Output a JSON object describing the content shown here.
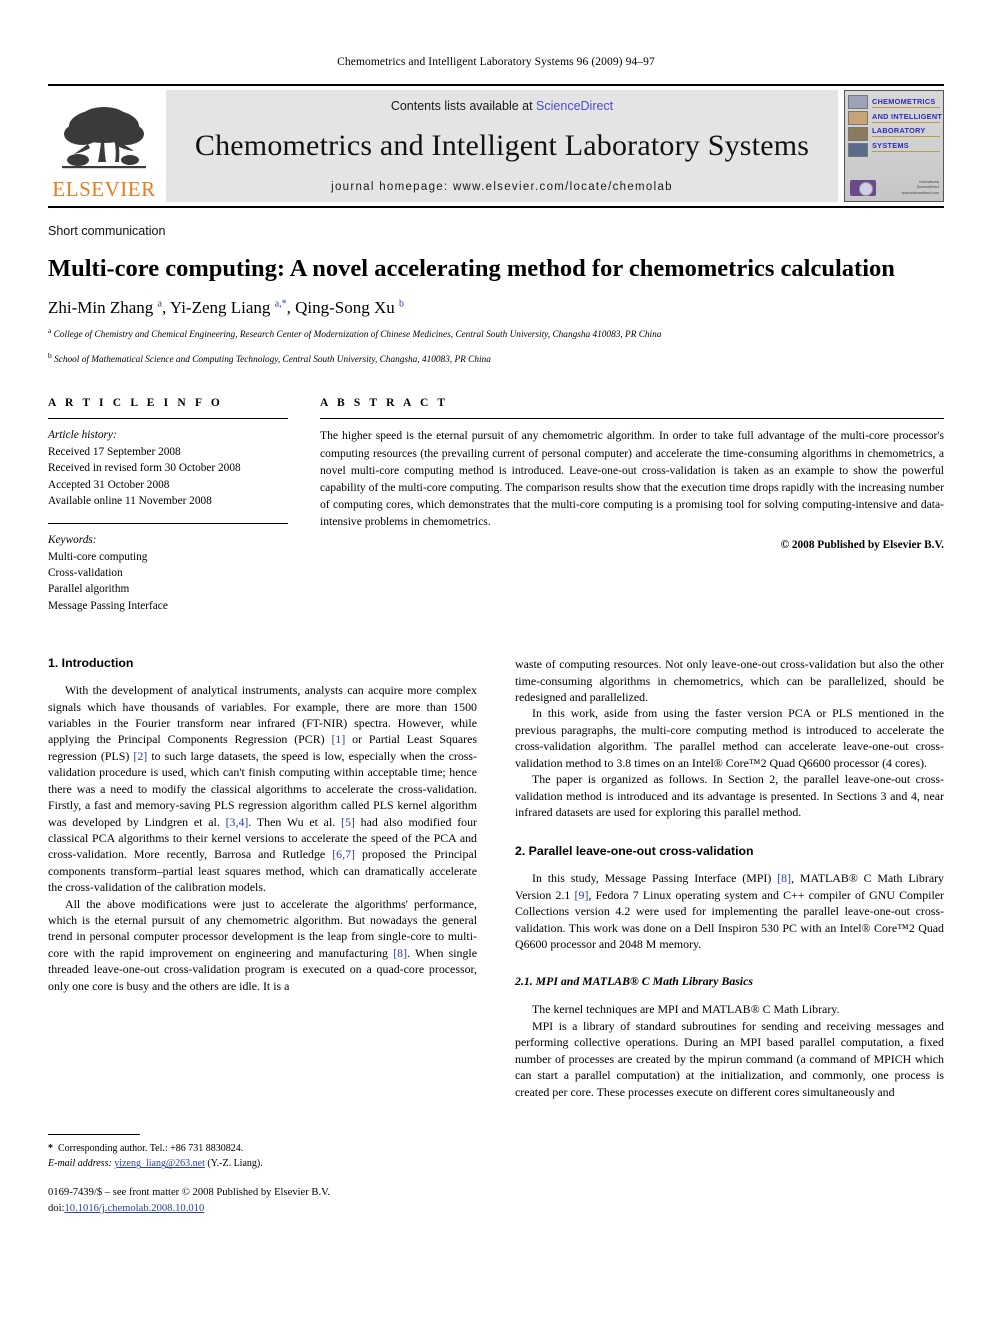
{
  "running_head": "Chemometrics and Intelligent Laboratory Systems 96 (2009) 94–97",
  "masthead": {
    "publisher_name": "ELSEVIER",
    "contents_prefix": "Contents lists available at ",
    "contents_link": "ScienceDirect",
    "journal_title": "Chemometrics and Intelligent Laboratory Systems",
    "homepage": "journal homepage: www.elsevier.com/locate/chemolab",
    "cover": {
      "lines": [
        "CHEMOMETRICS",
        "AND INTELLIGENT",
        "LABORATORY",
        "SYSTEMS"
      ],
      "footer1": "International",
      "footer2": "ScienceDirect",
      "footer3": "www.sciencedirect.com"
    }
  },
  "article": {
    "doc_type": "Short communication",
    "title": "Multi-core computing: A novel accelerating method for chemometrics calculation",
    "authors_html": "Zhi-Min Zhang <sup>a</sup>, Yi-Zeng Liang <sup>a,*</sup>, Qing-Song Xu <sup>b</sup>",
    "affiliations": [
      "College of Chemistry and Chemical Engineering, Research Center of Modernization of Chinese Medicines, Central South University, Changsha 410083, PR China",
      "School of Mathematical Science and Computing Technology, Central South University, Changsha, 410083, PR China"
    ]
  },
  "info": {
    "heading": "A R T I C L E   I N F O",
    "history_label": "Article history:",
    "history": [
      "Received 17 September 2008",
      "Received in revised form 30 October 2008",
      "Accepted 31 October 2008",
      "Available online 11 November 2008"
    ],
    "keywords_label": "Keywords:",
    "keywords": [
      "Multi-core computing",
      "Cross-validation",
      "Parallel algorithm",
      "Message Passing Interface"
    ]
  },
  "abstract": {
    "heading": "A B S T R A C T",
    "text": "The higher speed is the eternal pursuit of any chemometric algorithm. In order to take full advantage of the multi-core processor's computing resources (the prevailing current of personal computer) and accelerate the time-consuming algorithms in chemometrics, a novel multi-core computing method is introduced. Leave-one-out cross-validation is taken as an example to show the powerful capability of the multi-core computing. The comparison results show that the execution time drops rapidly with the increasing number of computing cores, which demonstrates that the multi-core computing is a promising tool for solving computing-intensive and data-intensive problems in chemometrics.",
    "copyright": "© 2008 Published by Elsevier B.V."
  },
  "body": {
    "left": {
      "section1_heading": "1. Introduction",
      "p1_html": "With the development of analytical instruments, analysts can acquire more complex signals which have thousands of variables. For example, there are more than 1500 variables in the Fourier transform near infrared (FT-NIR) spectra. However, while applying the Principal Components Regression (PCR) <span class=\"ref\">[1]</span> or Partial Least Squares regression (PLS) <span class=\"ref\">[2]</span> to such large datasets, the speed is low, especially when the cross-validation procedure is used, which can't finish computing within acceptable time; hence there was a need to modify the classical algorithms to accelerate the cross-validation. Firstly, a fast and memory-saving PLS regression algorithm called PLS kernel algorithm was developed by Lindgren et al. <span class=\"ref\">[3,4]</span>. Then Wu et al. <span class=\"ref\">[5]</span> had also modified four classical PCA algorithms to their kernel versions to accelerate the speed of the PCA and cross-validation. More recently, Barrosa and Rutledge <span class=\"ref\">[6,7]</span> proposed the Principal components transform–partial least squares method, which can dramatically accelerate the cross-validation of the calibration models.",
      "p2_html": "All the above modifications were just to accelerate the algorithms' performance, which is the eternal pursuit of any chemometric algorithm. But nowadays the general trend in personal computer processor development is the leap from single-core to multi-core with the rapid improvement on engineering and manufacturing <span class=\"ref\">[8]</span>. When single threaded leave-one-out cross-validation program is executed on a quad-core processor, only one core is busy and the others are idle. It is a"
    },
    "right": {
      "p1_html": "waste of computing resources. Not only leave-one-out cross-validation but also the other time-consuming algorithms in chemometrics, which can be parallelized, should be redesigned and parallelized.",
      "p2_html": "In this work, aside from using the faster version PCA or PLS mentioned in the previous paragraphs, the multi-core computing method is introduced to accelerate the cross-validation algorithm. The parallel method can accelerate leave-one-out cross-validation method to 3.8 times on an Intel® Core™2 Quad Q6600 processor (4 cores).",
      "p3_html": "The paper is organized as follows. In Section 2, the parallel leave-one-out cross-validation method is introduced and its advantage is presented. In Sections 3 and 4, near infrared datasets are used for exploring this parallel method.",
      "section2_heading": "2. Parallel leave-one-out cross-validation",
      "p4_html": "In this study, Message Passing Interface (MPI) <span class=\"ref\">[8]</span>, MATLAB® C Math Library Version 2.1 <span class=\"ref\">[9]</span>, Fedora 7 Linux operating system and C++ compiler of GNU Compiler Collections version 4.2 were used for implementing the parallel leave-one-out cross-validation. This work was done on a Dell Inspiron 530 PC with an Intel® Core™2 Quad Q6600 processor and 2048 M memory.",
      "section21_heading": "2.1. MPI and MATLAB® C Math Library Basics",
      "p5_html": "The kernel techniques are MPI and MATLAB® C Math Library.",
      "p6_html": "MPI is a library of standard subroutines for sending and receiving messages and performing collective operations. During an MPI based parallel computation, a fixed number of processes are created by the mpirun command (a command of MPICH which can start a parallel computation) at the initialization, and commonly, one process is created per core. These processes execute on different cores simultaneously and"
    }
  },
  "footnote": {
    "corresponding_html": "<b>*</b>&nbsp; Corresponding author. Tel.: +86 731 8830824.",
    "email_label": "E-mail address:",
    "email": "yizeng_liang@263.net",
    "email_suffix": "(Y.-Z. Liang).",
    "issn_line": "0169-7439/$ – see front matter © 2008 Published by Elsevier B.V.",
    "doi_label": "doi:",
    "doi": "10.1016/j.chemolab.2008.10.010"
  },
  "colors": {
    "link": "#2b3fa0",
    "sciencedirect": "#4c4ccc",
    "elsevier_orange": "#E87D1E",
    "cover_blue": "#2b2bb5"
  }
}
